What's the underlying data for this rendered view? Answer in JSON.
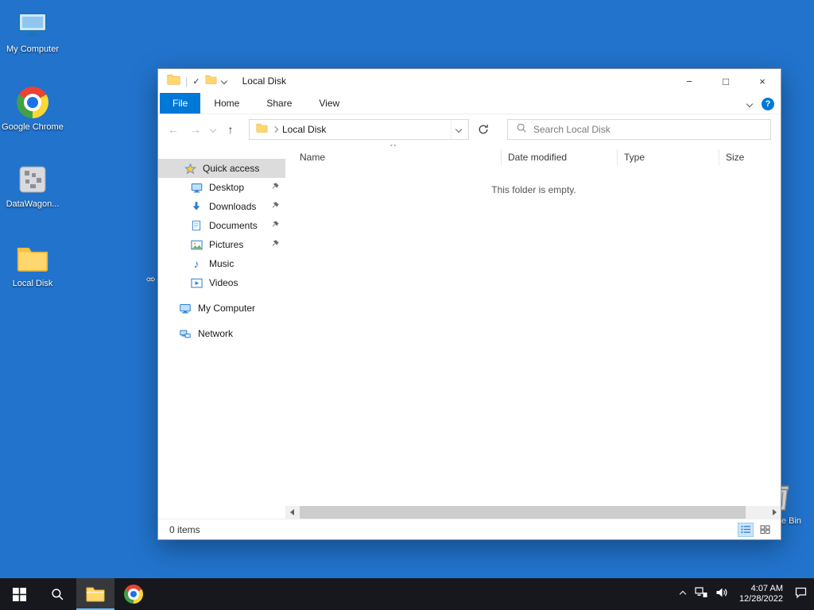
{
  "colors": {
    "desktop_bg": "#2173cc",
    "accent": "#0078d7",
    "taskbar_bg": "#16181d",
    "folder_main": "#ffd76e",
    "folder_dark": "#e8b33c"
  },
  "desktop": {
    "icons": [
      {
        "label": "My Computer"
      },
      {
        "label": "Google Chrome"
      },
      {
        "label": "DataWagon..."
      },
      {
        "label": "Local Disk"
      },
      {
        "label": "Recycle Bin"
      }
    ]
  },
  "window": {
    "title": "Local Disk",
    "qat_check_glyph": "✓",
    "controls": {
      "minimize": "−",
      "maximize": "□",
      "close": "×"
    },
    "tabs": [
      {
        "label": "File"
      },
      {
        "label": "Home"
      },
      {
        "label": "Share"
      },
      {
        "label": "View"
      }
    ],
    "help_glyph": "?",
    "nav": {
      "back": "←",
      "forward": "→",
      "up": "↑",
      "address": "Local Disk",
      "search_placeholder": "Search Local Disk"
    },
    "columns": [
      {
        "label": "Name"
      },
      {
        "label": "Date modified"
      },
      {
        "label": "Type"
      },
      {
        "label": "Size"
      }
    ],
    "empty_message": "This folder is empty.",
    "status": "0 items",
    "sidebar": {
      "quick_access_label": "Quick access",
      "pinned_items": [
        {
          "label": "Desktop",
          "pinned": true
        },
        {
          "label": "Downloads",
          "pinned": true
        },
        {
          "label": "Documents",
          "pinned": true
        },
        {
          "label": "Pictures",
          "pinned": true
        },
        {
          "label": "Music",
          "pinned": false
        },
        {
          "label": "Videos",
          "pinned": false
        }
      ],
      "computer_label": "My Computer",
      "network_label": "Network"
    }
  },
  "taskbar": {
    "clock": {
      "time": "4:07 AM",
      "date": "12/28/2022"
    }
  }
}
